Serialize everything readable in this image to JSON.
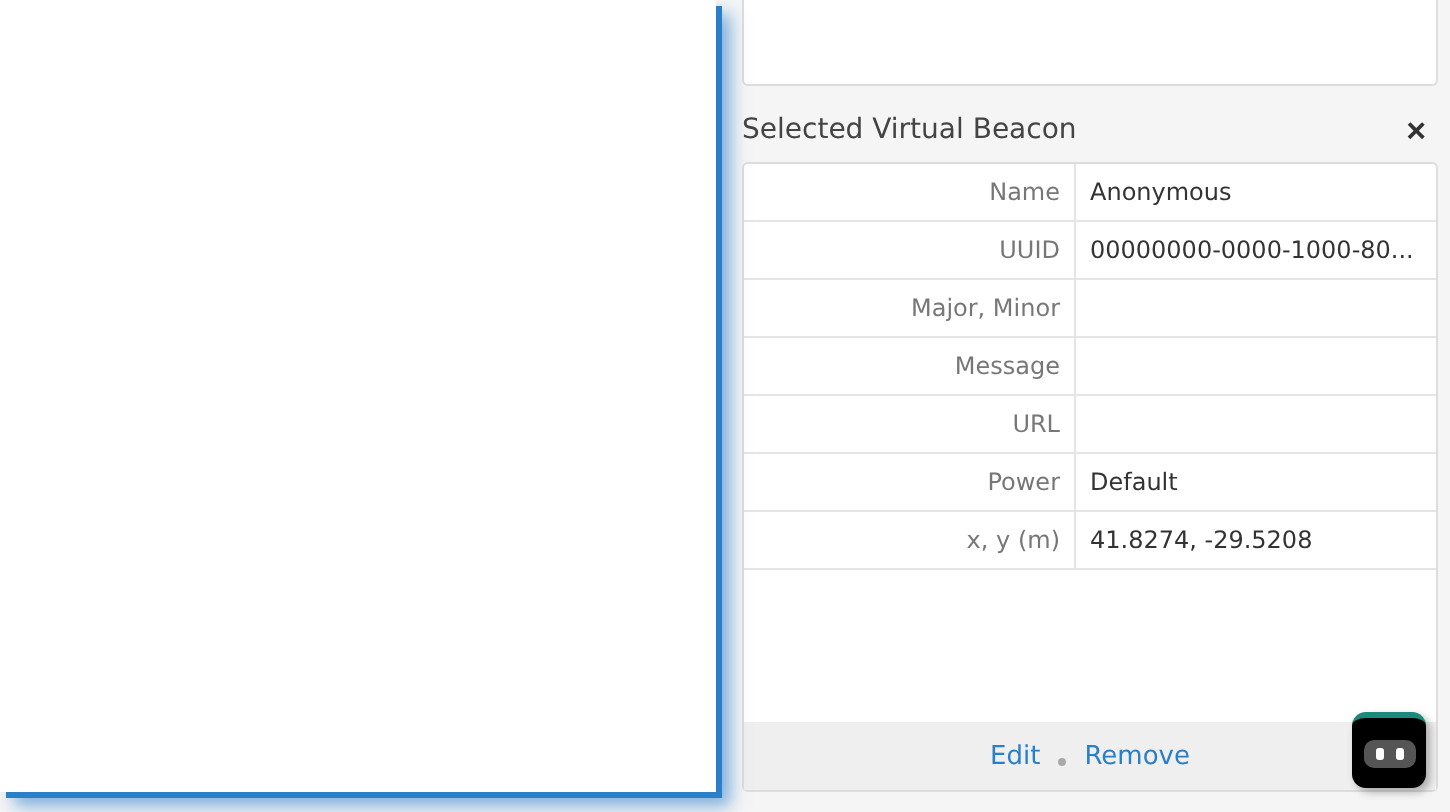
{
  "panel": {
    "title": "Selected Virtual Beacon",
    "close": "×",
    "rows": [
      {
        "label": "Name",
        "value": "Anonymous"
      },
      {
        "label": "UUID",
        "value": "00000000-0000-1000-80..."
      },
      {
        "label": "Major, Minor",
        "value": ""
      },
      {
        "label": "Message",
        "value": ""
      },
      {
        "label": "URL",
        "value": ""
      },
      {
        "label": "Power",
        "value": "Default"
      },
      {
        "label": "x, y (m)",
        "value": "41.8274, -29.5208"
      }
    ],
    "actions": [
      "Edit",
      "Remove"
    ]
  }
}
